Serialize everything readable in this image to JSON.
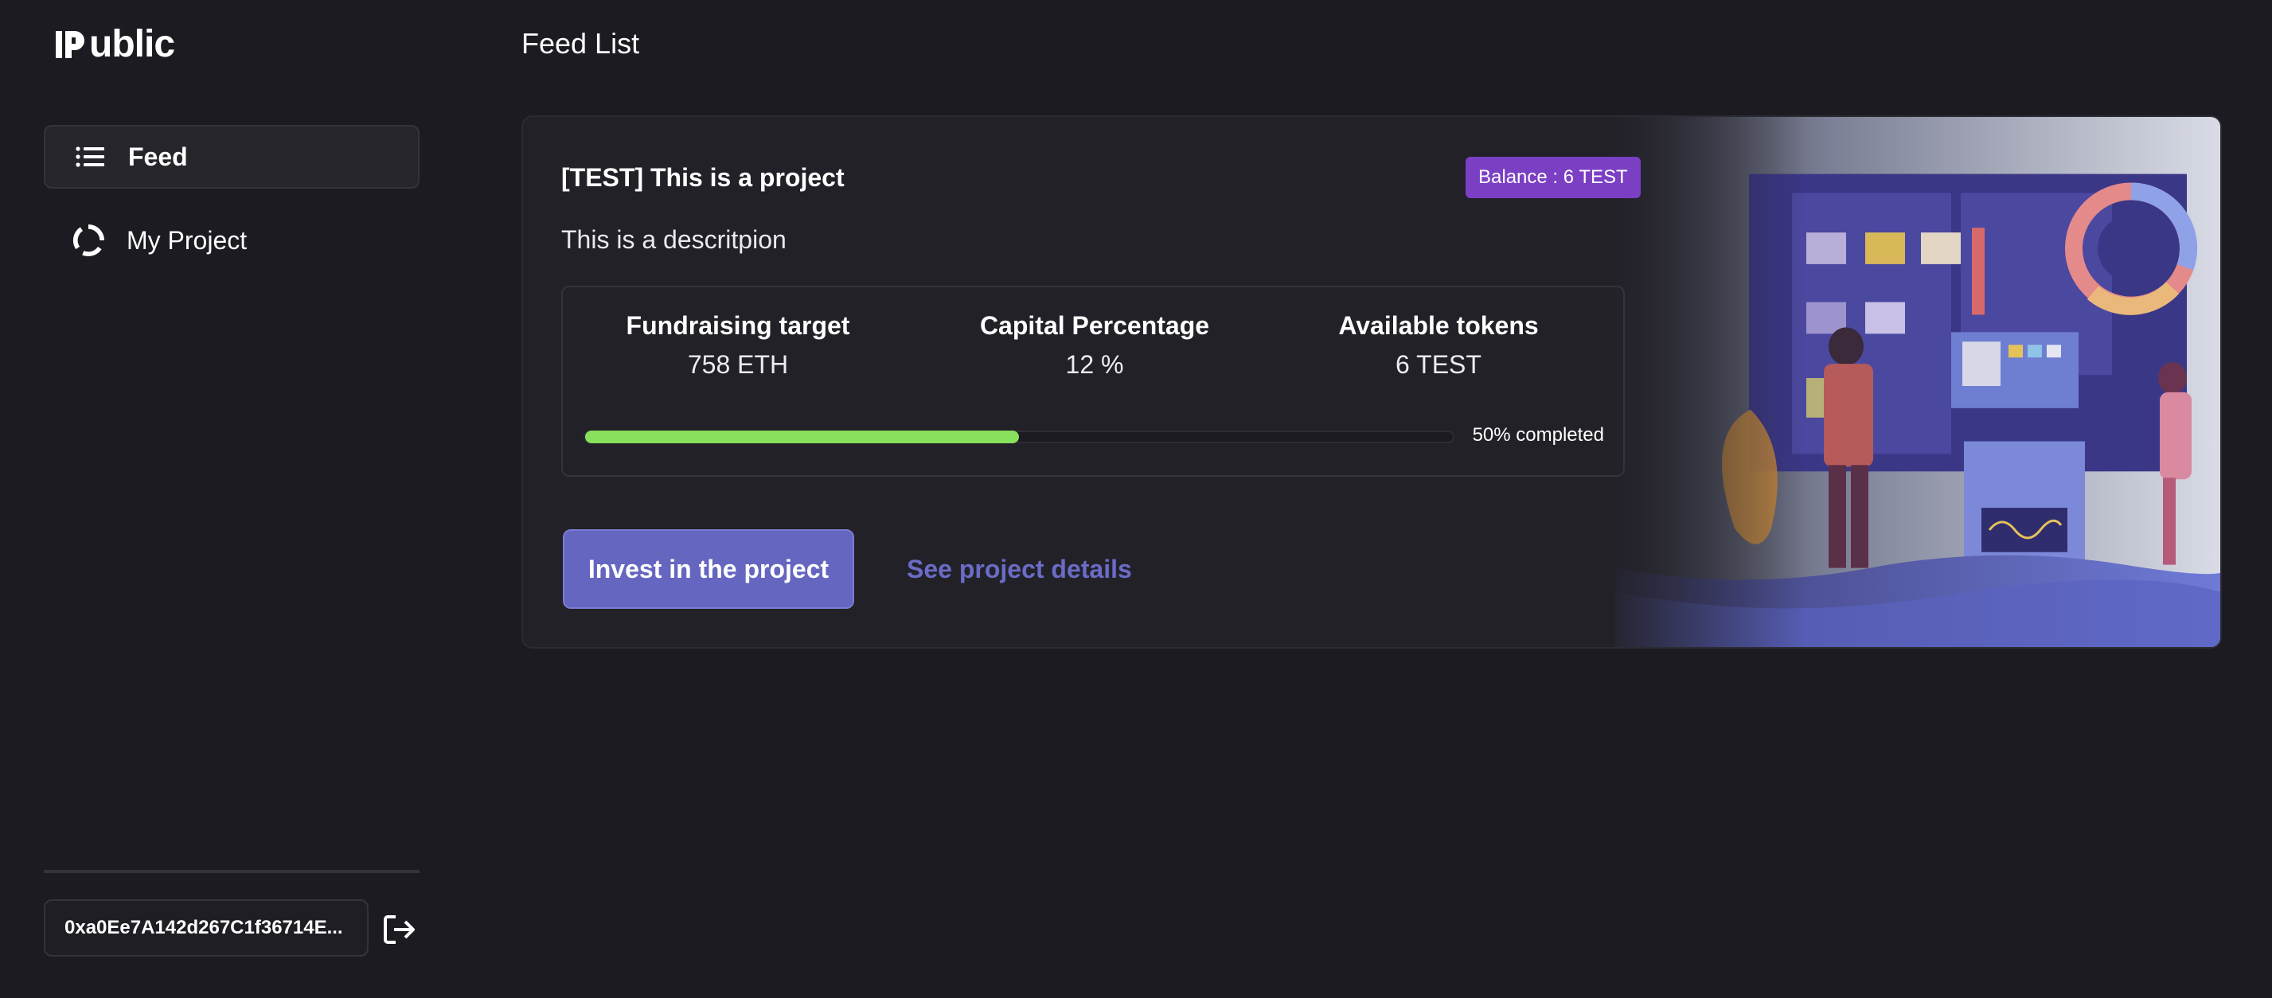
{
  "sidebar": {
    "logo_text": "ublic",
    "nav": [
      {
        "label": "Feed",
        "icon": "list-icon",
        "active": true
      },
      {
        "label": "My Project",
        "icon": "loader-circle-icon",
        "active": false
      }
    ],
    "wallet_address": "0xa0Ee7A142d267C1f36714E...",
    "logout_icon": "logout-icon"
  },
  "main": {
    "title": "Feed List",
    "card": {
      "project_title": "[TEST] This is a project",
      "balance_badge": "Balance : 6 TEST",
      "description": "This is a descritpion",
      "stats": [
        {
          "label": "Fundraising target",
          "value": "758 ETH"
        },
        {
          "label": "Capital Percentage",
          "value": "12 %"
        },
        {
          "label": "Available tokens",
          "value": "6 TEST"
        }
      ],
      "progress": {
        "percent": 50,
        "text": "50% completed"
      },
      "invest_button": "Invest in the project",
      "details_link": "See project details"
    }
  },
  "colors": {
    "background": "#1c1b21",
    "card": "#222128",
    "accent": "#6466c0",
    "badge": "#7b3fc4",
    "progress": "#88e05c"
  }
}
